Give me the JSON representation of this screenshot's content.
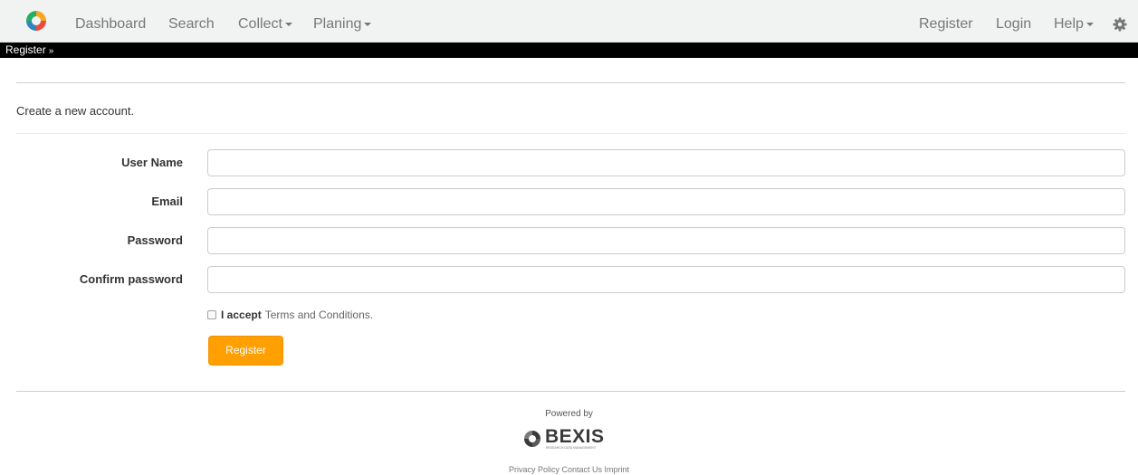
{
  "nav": {
    "items": [
      {
        "label": "Dashboard"
      },
      {
        "label": "Search"
      },
      {
        "label": "Collect"
      },
      {
        "label": "Planing"
      }
    ],
    "right_items": [
      {
        "label": "Register"
      },
      {
        "label": "Login"
      },
      {
        "label": "Help"
      }
    ],
    "settings_icon": "gear-icon",
    "logo_colors": [
      "#e84c3d",
      "#f5a623",
      "#2e86c1",
      "#27ae60"
    ]
  },
  "breadcrumb": {
    "label": "Register",
    "icon": "double-chevron-down-icon"
  },
  "form": {
    "intro": "Create a new account.",
    "fields": [
      {
        "label": "User Name",
        "value": ""
      },
      {
        "label": "Email",
        "value": ""
      },
      {
        "label": "Password",
        "value": ""
      },
      {
        "label": "Confirm password",
        "value": ""
      }
    ],
    "accept_text": "I accept",
    "terms_link": "Terms and Conditions.",
    "terms_checked": false,
    "submit_label": "Register",
    "accent_color": "#ff9f00"
  },
  "footer": {
    "powered_by": "Powered by",
    "logo_text": "BEXIS",
    "logo_tagline": "RESEARCH DATA MANAGEMENT",
    "links": [
      "Privacy Policy",
      "Contact Us",
      "Imprint"
    ]
  }
}
